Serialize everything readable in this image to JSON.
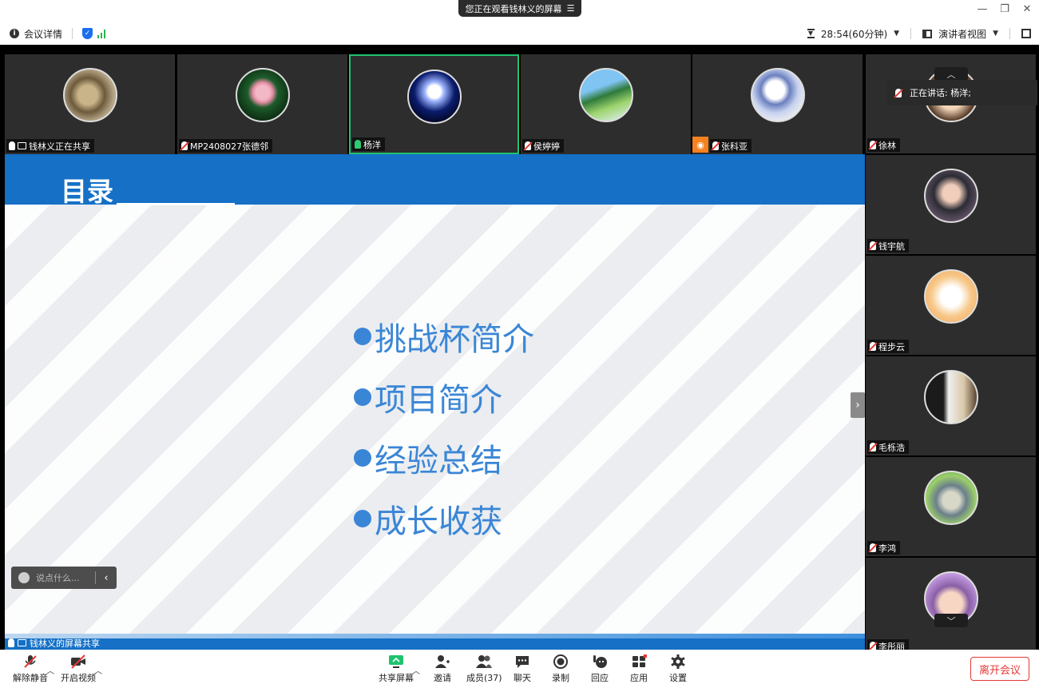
{
  "window": {
    "sharing_banner": "您正在观看钱林义的屏幕",
    "banner_menu_icon": "menu-icon",
    "minimize": "—",
    "restore": "❐",
    "close": "✕"
  },
  "infobar": {
    "meeting_details": "会议详情",
    "timer": "28:54(60分钟)",
    "view_mode": "演讲者视图"
  },
  "speaking": {
    "text": "正在讲话:  杨洋;"
  },
  "top_tiles": [
    {
      "name": "钱林义正在共享"
    },
    {
      "name": "MP2408027张德邻"
    },
    {
      "name": "杨洋"
    },
    {
      "name": "侯婷婷"
    },
    {
      "name": "张科亚"
    }
  ],
  "right_tiles": [
    {
      "name": "徐林"
    },
    {
      "name": "钱宇航"
    },
    {
      "name": "程步云"
    },
    {
      "name": "毛栎浩"
    },
    {
      "name": "李鸿"
    },
    {
      "name": "李彤丽"
    }
  ],
  "slide": {
    "title": "目录",
    "items": [
      "挑战杯简介",
      "项目简介",
      "经验总结",
      "成长收获"
    ],
    "share_label": "钱林义的屏幕共享"
  },
  "chat": {
    "placeholder": "说点什么..."
  },
  "toolbar": {
    "unmute": "解除静音",
    "start_video": "开启视频",
    "share_screen": "共享屏幕",
    "invite": "邀请",
    "members": "成员(37)",
    "chat": "聊天",
    "record": "录制",
    "reactions": "回应",
    "apps": "应用",
    "settings": "设置",
    "leave": "离开会议"
  },
  "colors": {
    "accent": "#1570c6",
    "slide_text": "#3a86d6",
    "active_border": "#1ec36f",
    "leave": "#e53935"
  }
}
